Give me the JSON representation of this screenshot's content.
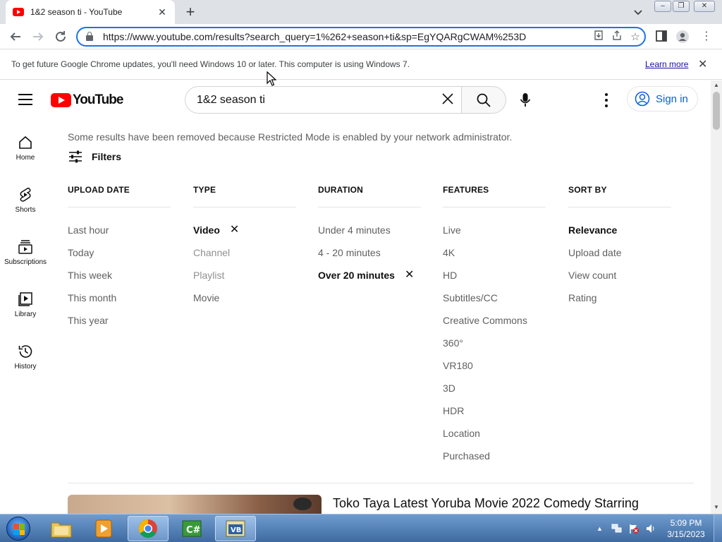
{
  "browser": {
    "tab_title": "1&2 season ti - YouTube",
    "url": "https://www.youtube.com/results?search_query=1%262+season+ti&sp=EgYQARgCWAM%253D",
    "tab_close": "✕",
    "new_tab": "+"
  },
  "infobar": {
    "message": "To get future Google Chrome updates, you'll need Windows 10 or later. This computer is using Windows 7.",
    "learn_more": "Learn more",
    "close": "✕"
  },
  "youtube": {
    "logo_text": "YouTube",
    "search_value": "1&2 season ti",
    "sign_in": "Sign in",
    "guide": [
      {
        "label": "Home",
        "icon": "home-icon"
      },
      {
        "label": "Shorts",
        "icon": "shorts-icon"
      },
      {
        "label": "Subscriptions",
        "icon": "subscriptions-icon"
      },
      {
        "label": "Library",
        "icon": "library-icon"
      },
      {
        "label": "History",
        "icon": "history-icon"
      }
    ],
    "restricted_notice": "Some results have been removed because Restricted Mode is enabled by your network administrator.",
    "filters_label": "Filters",
    "filter_columns": [
      {
        "heading": "UPLOAD DATE",
        "options": [
          "Last hour",
          "Today",
          "This week",
          "This month",
          "This year"
        ]
      },
      {
        "heading": "TYPE",
        "options": [
          "Video",
          "Channel",
          "Playlist",
          "Movie"
        ],
        "selected": "Video",
        "disabled": [
          "Channel",
          "Playlist"
        ]
      },
      {
        "heading": "DURATION",
        "options": [
          "Under 4 minutes",
          "4 - 20 minutes",
          "Over 20 minutes"
        ],
        "selected": "Over 20 minutes"
      },
      {
        "heading": "FEATURES",
        "options": [
          "Live",
          "4K",
          "HD",
          "Subtitles/CC",
          "Creative Commons",
          "360°",
          "VR180",
          "3D",
          "HDR",
          "Location",
          "Purchased"
        ]
      },
      {
        "heading": "SORT BY",
        "options": [
          "Relevance",
          "Upload date",
          "View count",
          "Rating"
        ],
        "selected": "Relevance"
      }
    ],
    "first_result_title": "Toko Taya Latest Yoruba Movie 2022 Comedy Starring"
  },
  "taskbar": {
    "apps": [
      "file-explorer",
      "media-player",
      "chrome",
      "csharp-ide",
      "vb-ide"
    ],
    "active_app": "chrome",
    "time": "5:09 PM",
    "date": "3/15/2023"
  },
  "colors": {
    "youtube_red": "#ff0000",
    "link_blue": "#065fd4",
    "omnibox_focus": "#1a73e8"
  }
}
